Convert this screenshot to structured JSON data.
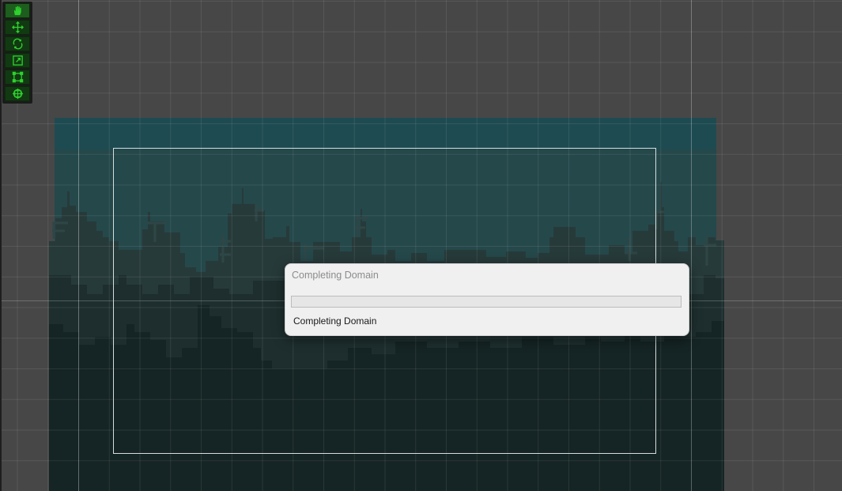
{
  "dialog": {
    "title": "Completing Domain",
    "status": "Completing Domain",
    "progress_percent": 0
  },
  "toolbar": {
    "tools": [
      {
        "icon": "hand-icon",
        "active": true
      },
      {
        "icon": "move-icon",
        "active": false
      },
      {
        "icon": "rotate-icon",
        "active": false
      },
      {
        "icon": "scale-icon",
        "active": false
      },
      {
        "icon": "rect-transform-icon",
        "active": false
      },
      {
        "icon": "transform-all-icon",
        "active": false
      }
    ]
  },
  "colors": {
    "viewport_bg": "#474747",
    "sky": "#25484b",
    "sky_top": "#1d4c52",
    "building_far": "#273a3a",
    "building_mid": "#1e2e2e",
    "building_near": "#152424",
    "toolbar_icon": "#2fd12f",
    "progress_fill": "#06b025"
  }
}
